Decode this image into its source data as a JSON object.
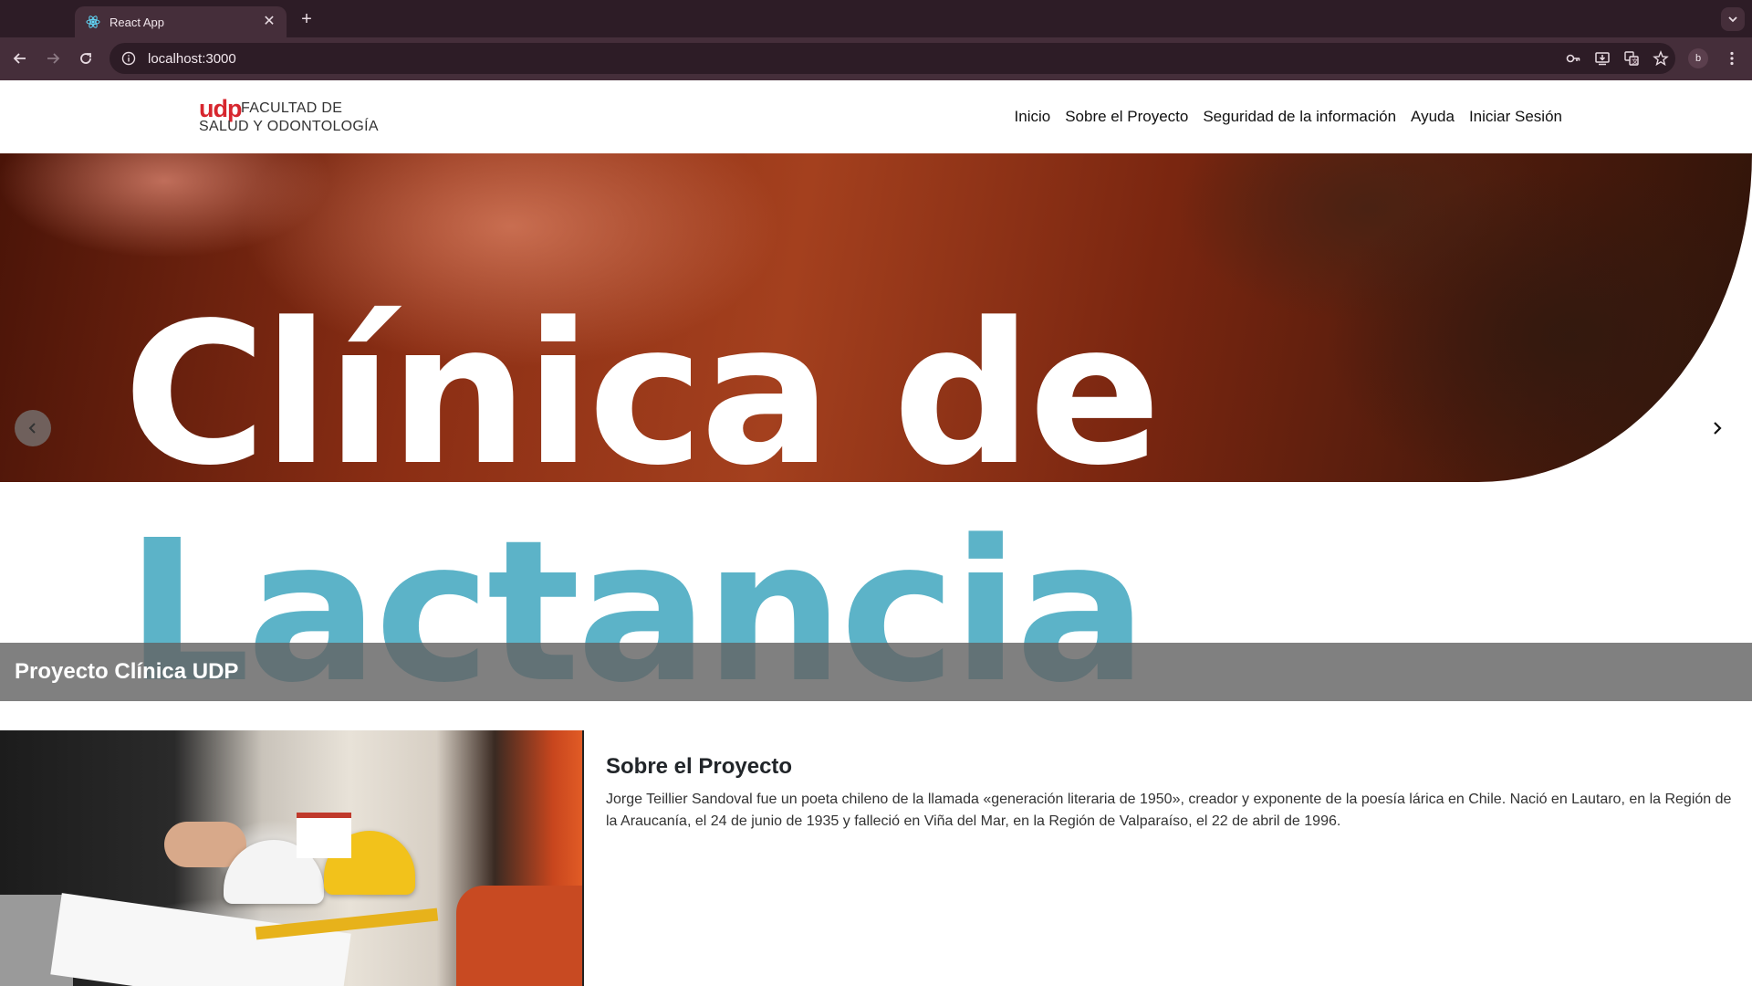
{
  "browser": {
    "tab_title": "React App",
    "url": "localhost:3000",
    "profile_initial": "b",
    "icons": {
      "favicon": "react-atom-icon",
      "close": "close-icon",
      "new_tab": "plus-icon",
      "tab_menu": "chevron-down-icon",
      "back": "back-arrow-icon",
      "forward": "forward-arrow-icon",
      "reload": "reload-icon",
      "site_info": "info-icon",
      "password": "key-icon",
      "install": "install-app-icon",
      "translate": "translate-icon",
      "bookmark": "star-icon",
      "menu": "kebab-menu-icon"
    },
    "colors": {
      "frame": "#2d1c26",
      "toolbar": "#452e3a"
    }
  },
  "header": {
    "logo": {
      "brand": "udp",
      "line1": "FACULTAD DE",
      "line2": "SALUD Y ODONTOLOGÍA",
      "brand_color": "#d7262e"
    },
    "nav": [
      "Inicio",
      "Sobre el Proyecto",
      "Seguridad de la información",
      "Ayuda",
      "Iniciar Sesión"
    ]
  },
  "hero": {
    "image_text_line1": "Clínica de",
    "image_text_line2": "Lactancia",
    "caption": "Proyecto Clínica UDP",
    "accent_color": "#5cb3c8",
    "prev_icon": "chevron-left-icon",
    "next_icon": "chevron-right-icon"
  },
  "about": {
    "title": "Sobre el Proyecto",
    "body": "Jorge Teillier Sandoval fue un poeta chileno de la llamada «generación literaria de 1950», creador y exponente de la poesía lárica en Chile. Nació en Lautaro, en la Región de la Araucanía, el 24 de junio de 1935 y falleció en Viña del Mar, en la Región de Valparaíso, el 22 de abril de 1996."
  }
}
